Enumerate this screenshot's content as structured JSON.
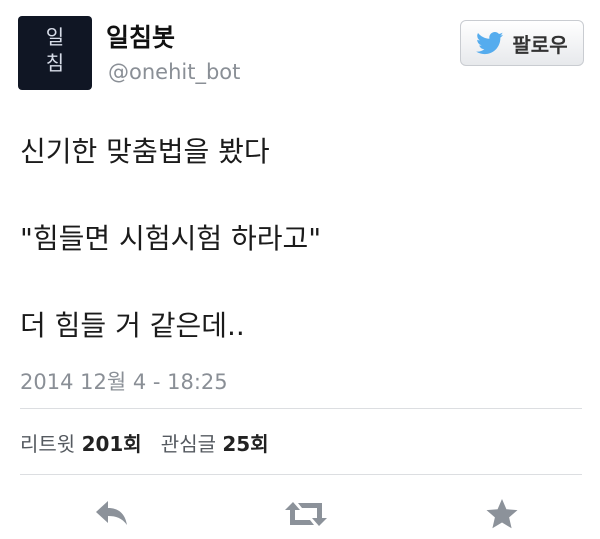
{
  "user": {
    "display_name": "일침봇",
    "username": "@onehit_bot",
    "avatar_text": "일침"
  },
  "follow_button": {
    "label": "팔로우",
    "icon": "twitter-bird-icon"
  },
  "tweet": {
    "lines": [
      "신기한 맞춤법을 봤다",
      "\"힘들면 시험시험 하라고\"",
      "더 힘들 거 같은데.."
    ],
    "timestamp": "2014 12월 4 - 18:25"
  },
  "stats": {
    "retweets_label": "리트윗",
    "retweets_value": "201회",
    "favorites_label": "관심글",
    "favorites_value": "25회"
  },
  "actions": {
    "reply_icon": "reply-icon",
    "retweet_icon": "retweet-icon",
    "favorite_icon": "star-icon"
  },
  "colors": {
    "twitter_blue": "#55acee",
    "muted_text": "#8a8f96",
    "avatar_bg": "#101624"
  }
}
